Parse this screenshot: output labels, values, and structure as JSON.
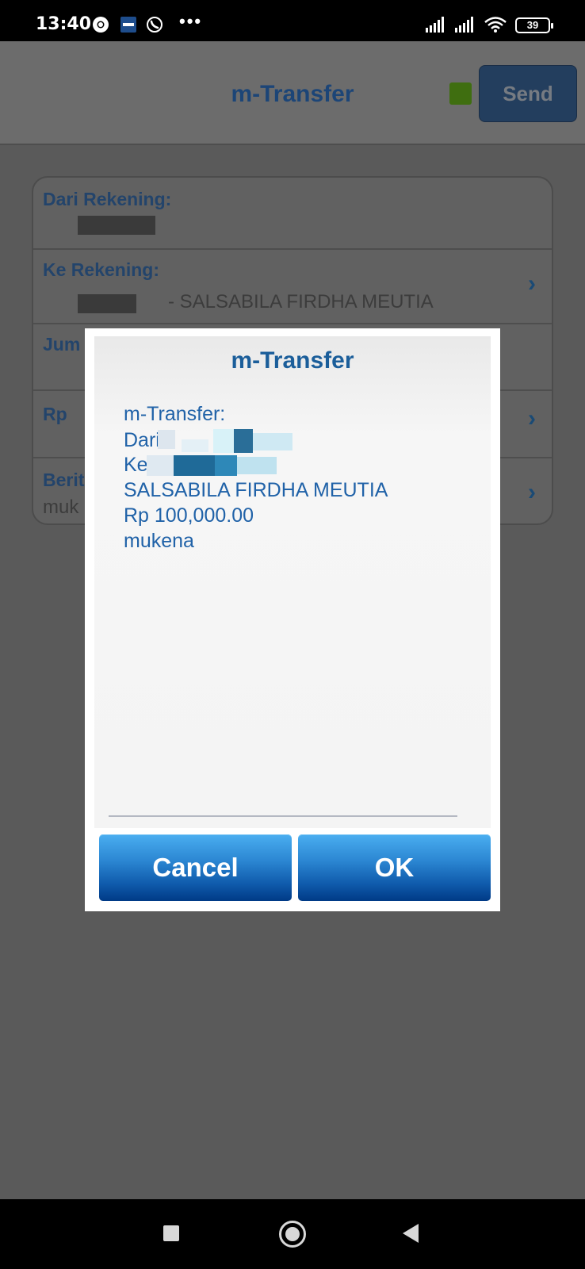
{
  "status_bar": {
    "time": "13:40",
    "battery": "39",
    "icons": [
      "chrome-icon",
      "app-icon",
      "whatsapp-icon",
      "more-dots-icon",
      "signal-icon",
      "signal-icon",
      "wifi-icon",
      "battery-icon"
    ]
  },
  "header": {
    "title": "m-Transfer",
    "send_label": "Send",
    "indicator_color": "#5a9c17"
  },
  "form": {
    "rows": [
      {
        "label": "Dari Rekening:",
        "value": ""
      },
      {
        "label": "Ke Rekening:",
        "value": "- SALSABILA FIRDHA MEUTIA"
      },
      {
        "label": "Jum",
        "value": ""
      },
      {
        "label": "Rp",
        "value": ""
      },
      {
        "label": "Berit",
        "value": "muk"
      }
    ]
  },
  "dialog": {
    "title": "m-Transfer",
    "lines": [
      "m-Transfer:",
      "Dari",
      "Ke",
      "SALSABILA FIRDHA MEUTIA",
      "Rp 100,000.00",
      "mukena"
    ],
    "cancel_label": "Cancel",
    "ok_label": "OK"
  },
  "colors": {
    "accent": "#1b5e9a",
    "button_top": "#4aaef0",
    "button_bottom": "#003a86"
  }
}
